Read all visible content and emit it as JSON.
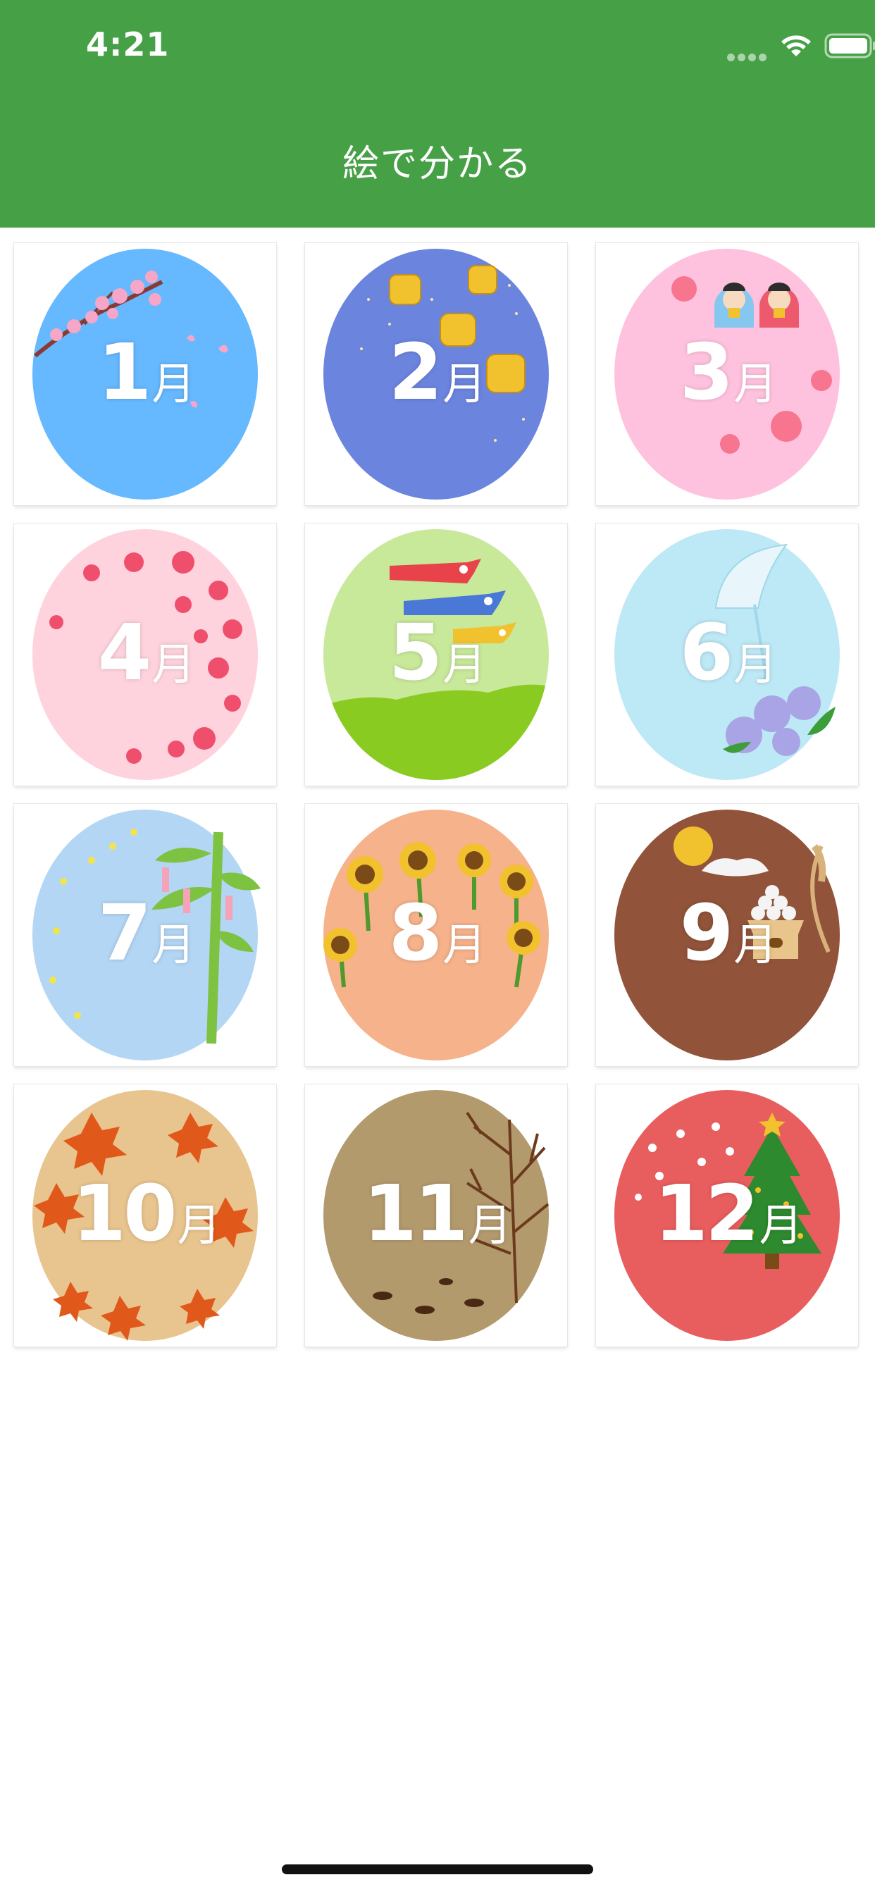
{
  "status_bar": {
    "time": "4:21"
  },
  "nav": {
    "title": "絵で分かる"
  },
  "months": [
    {
      "number": "1",
      "kanji": "月",
      "bg": "#66b8ff",
      "theme": "cherry-blossom-branch"
    },
    {
      "number": "2",
      "kanji": "月",
      "bg": "#6b84de",
      "theme": "roasted-beans"
    },
    {
      "number": "3",
      "kanji": "月",
      "bg": "#ffc2de",
      "theme": "hina-dolls"
    },
    {
      "number": "4",
      "kanji": "月",
      "bg": "#ffd3dd",
      "theme": "sakura-petals"
    },
    {
      "number": "5",
      "kanji": "月",
      "bg": "#c8e89a",
      "theme": "koinobori"
    },
    {
      "number": "6",
      "kanji": "月",
      "bg": "#bde8f5",
      "theme": "umbrella-hydrangea"
    },
    {
      "number": "7",
      "kanji": "月",
      "bg": "#b3d6f5",
      "theme": "tanabata"
    },
    {
      "number": "8",
      "kanji": "月",
      "bg": "#f6b28a",
      "theme": "sunflowers"
    },
    {
      "number": "9",
      "kanji": "月",
      "bg": "#91533a",
      "theme": "moon-viewing"
    },
    {
      "number": "10",
      "kanji": "月",
      "bg": "#e8c48f",
      "theme": "autumn-leaves"
    },
    {
      "number": "11",
      "kanji": "月",
      "bg": "#b39a6d",
      "theme": "bare-tree"
    },
    {
      "number": "12",
      "kanji": "月",
      "bg": "#e85d5d",
      "theme": "christmas-tree"
    }
  ],
  "colors": {
    "header": "#46a046",
    "background": "#ffffff"
  }
}
